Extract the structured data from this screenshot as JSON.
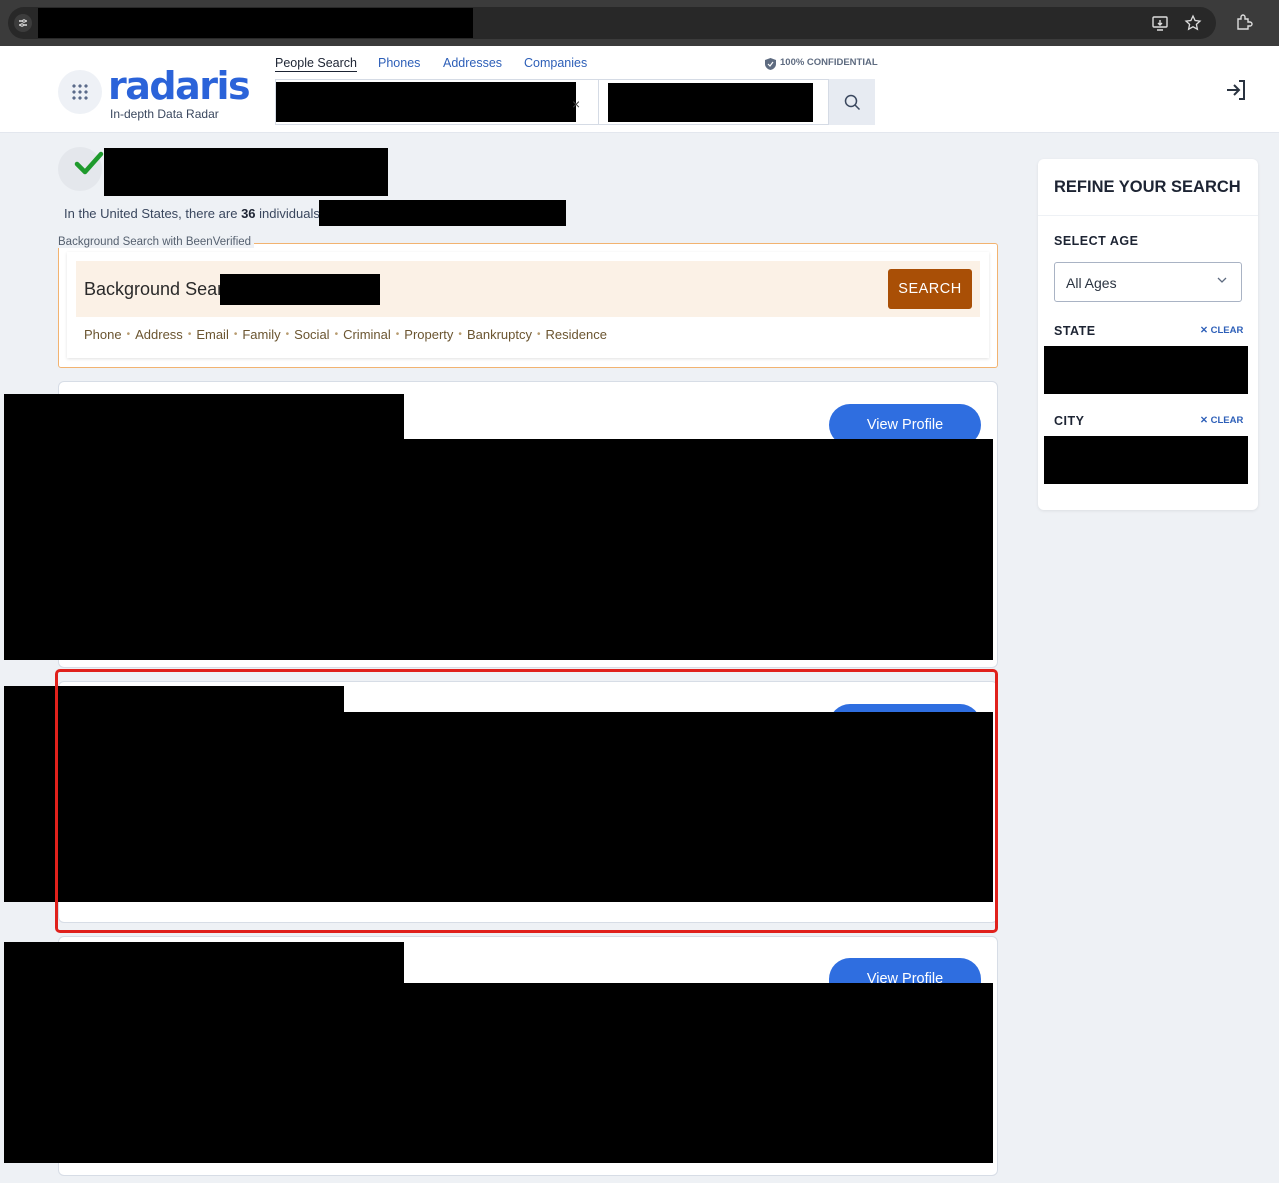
{
  "header": {
    "logo": "radaris",
    "tagline": "In-depth Data Radar",
    "tabs": [
      {
        "label": "People Search"
      },
      {
        "label": "Phones"
      },
      {
        "label": "Addresses"
      },
      {
        "label": "Companies"
      }
    ],
    "confidential": "100% CONFIDENTIAL"
  },
  "summary": {
    "prefix": "In the United States, there are ",
    "count": "36",
    "suffix": " individuals"
  },
  "background": {
    "label": "Background Search with BeenVerified",
    "title": "Background Sear",
    "search_button": "SEARCH",
    "links": [
      "Phone",
      "Address",
      "Email",
      "Family",
      "Social",
      "Criminal",
      "Property",
      "Bankruptcy",
      "Residence"
    ]
  },
  "results": {
    "view_profile": "View Profile"
  },
  "sidebar": {
    "title": "REFINE YOUR SEARCH",
    "age_label": "SELECT AGE",
    "age_value": "All Ages",
    "state_label": "STATE",
    "city_label": "CITY",
    "clear_label": "CLEAR"
  },
  "colors": {
    "brand": "#2b63d9",
    "search_button": "#a94f06",
    "view_profile": "#2f6ee0",
    "highlight_frame": "#e0211c"
  }
}
